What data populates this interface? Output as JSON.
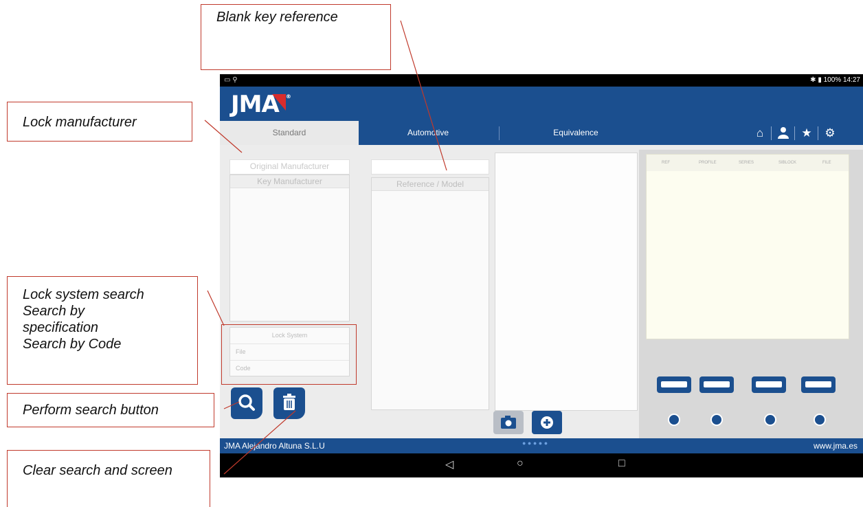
{
  "callouts": {
    "blank_key_reference": "Blank key reference",
    "lock_manufacturer": "Lock manufacturer",
    "lock_system_search": [
      "Lock system search",
      "Search by",
      "specification",
      "Search by Code"
    ],
    "perform_search": "Perform search button",
    "clear_search": "Clear search and screen"
  },
  "status_bar": {
    "right_text": "100% 14:27"
  },
  "app": {
    "logo": "JMA",
    "registered": "®"
  },
  "tabs": [
    "Standard",
    "Automotive",
    "Equivalence"
  ],
  "header_icons": [
    "home-icon",
    "user-icon",
    "star-icon",
    "gear-icon"
  ],
  "left_column": {
    "original_manufacturer_placeholder": "Original Manufacturer",
    "key_manufacturer_header": "Key Manufacturer",
    "search_fields": [
      "Lock System",
      "File",
      "Code"
    ]
  },
  "middle_column": {
    "reference_placeholder": "",
    "reference_header": "Reference / Model"
  },
  "results_table": {
    "columns": [
      "REF",
      "PROFILE",
      "SERIES",
      "SIBLOCK",
      "FILE"
    ]
  },
  "buttons": [
    "search-icon",
    "trash-icon",
    "camera-icon",
    "plus-icon"
  ],
  "key_types": [
    "key-profile-1-icon",
    "key-profile-2-icon",
    "key-profile-3-icon",
    "key-profile-4-icon"
  ],
  "footer": {
    "company": "JMA Alejandro Altuna S.L.U",
    "website": "www.jma.es"
  },
  "colors": {
    "brand_blue": "#1b4f8f",
    "accent_red": "#d92c2c",
    "callout_border": "#c0392b"
  }
}
